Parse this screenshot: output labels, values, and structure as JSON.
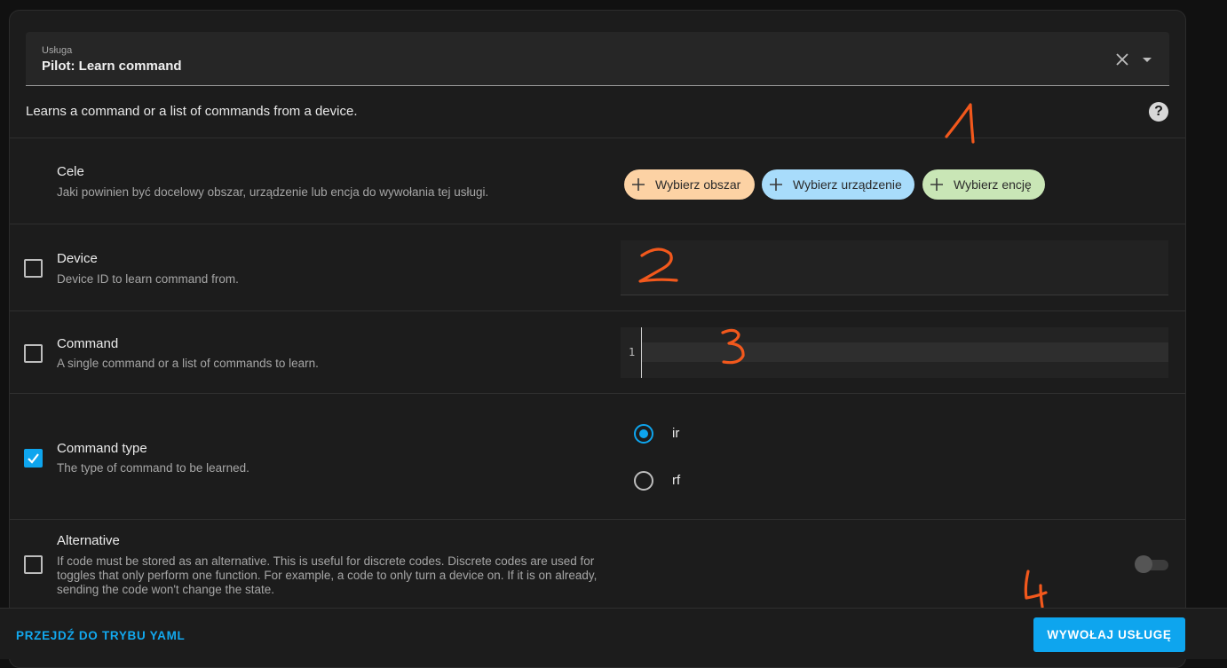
{
  "service": {
    "label": "Usługa",
    "value": "Pilot: Learn command",
    "description": "Learns a command or a list of commands from a device."
  },
  "help_icon": "question-mark-icon",
  "targets": {
    "title": "Cele",
    "subtitle": "Jaki powinien być docelowy obszar, urządzenie lub encja do wywołania tej usługi.",
    "chips": [
      {
        "label": "Wybierz obszar",
        "color": "#fcd2a4"
      },
      {
        "label": "Wybierz urządzenie",
        "color": "#a8dcfb"
      },
      {
        "label": "Wybierz encję",
        "color": "#c9e6b6"
      }
    ]
  },
  "fields": {
    "device": {
      "title": "Device",
      "subtitle": "Device ID to learn command from.",
      "checked": false
    },
    "command": {
      "title": "Command",
      "subtitle": "A single command or a list of commands to learn.",
      "checked": false,
      "line_number": "1"
    },
    "command_type": {
      "title": "Command type",
      "subtitle": "The type of command to be learned.",
      "checked": true,
      "options": [
        {
          "label": "ir",
          "selected": true
        },
        {
          "label": "rf",
          "selected": false
        }
      ]
    },
    "alternative": {
      "title": "Alternative",
      "subtitle_lines": [
        "If code must be stored as an alternative. This is useful for discrete codes. Discrete codes are used for",
        "toggles that only perform one function. For example, a code to only turn a device on. If it is on already,",
        "sending the code won't change the state."
      ],
      "checked": false,
      "toggle_on": false
    }
  },
  "footer": {
    "yaml_button": "PRZEJDŹ DO TRYBU YAML",
    "call_button": "WYWOŁAJ USŁUGĘ"
  },
  "annotations": [
    "1",
    "2",
    "3",
    "4"
  ],
  "colors": {
    "accent": "#0ea5ee",
    "annotation": "#f2581c"
  }
}
